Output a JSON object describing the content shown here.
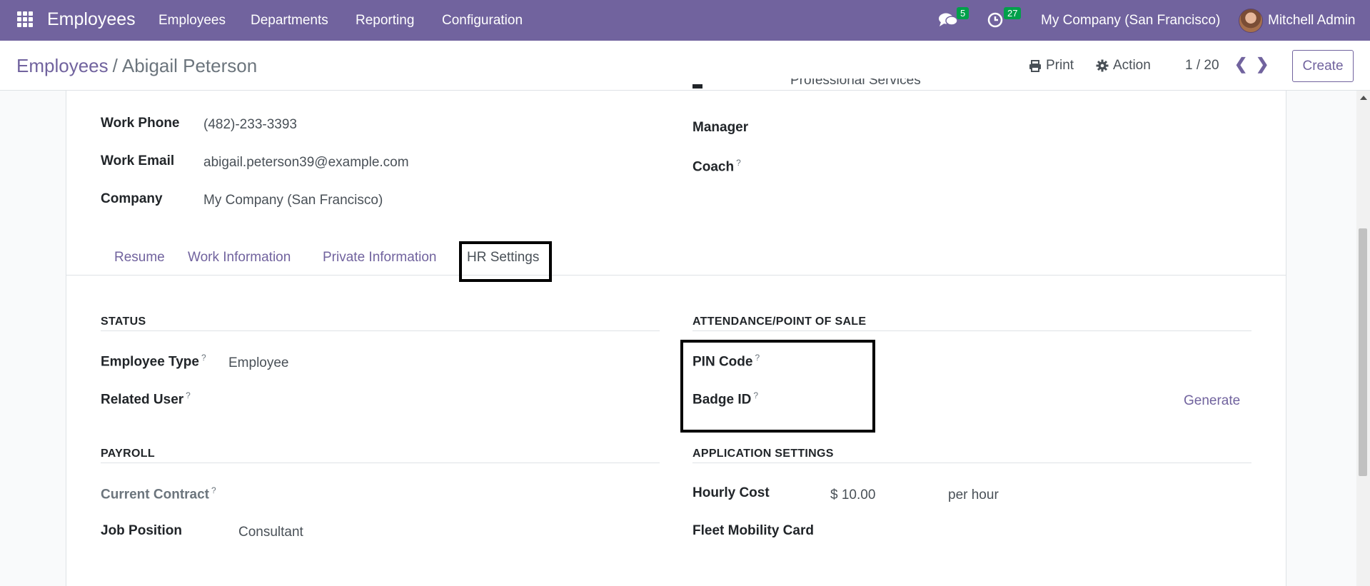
{
  "navbar": {
    "brand": "Employees",
    "menu": [
      "Employees",
      "Departments",
      "Reporting",
      "Configuration"
    ],
    "messages_count": "5",
    "activities_count": "27",
    "company": "My Company (San Francisco)",
    "user": "Mitchell Admin",
    "bg_color": "#71639e"
  },
  "control": {
    "breadcrumb_parent": "Employees",
    "breadcrumb_sep": "/",
    "breadcrumb_current": "Abigail Peterson",
    "print_label": "Print",
    "action_label": "Action",
    "pager": "1 / 20",
    "create_label": "Create"
  },
  "header_fields": {
    "work_phone_label": "Work Phone",
    "work_phone": "(482)-233-3393",
    "work_email_label": "Work Email",
    "work_email": "abigail.peterson39@example.com",
    "company_label": "Company",
    "company": "My Company (San Francisco)",
    "department_value_cut": "Professional Services",
    "manager_label": "Manager",
    "coach_label": "Coach"
  },
  "tabs": [
    "Resume",
    "Work Information",
    "Private Information",
    "HR Settings"
  ],
  "status": {
    "title": "STATUS",
    "employee_type_label": "Employee Type",
    "employee_type": "Employee",
    "related_user_label": "Related User"
  },
  "attendance": {
    "title": "ATTENDANCE/POINT OF SALE",
    "pin_label": "PIN Code",
    "badge_label": "Badge ID",
    "generate_label": "Generate"
  },
  "payroll": {
    "title": "PAYROLL",
    "contract_label": "Current Contract",
    "job_position_label": "Job Position",
    "job_position": "Consultant"
  },
  "application": {
    "title": "APPLICATION SETTINGS",
    "hourly_cost_label": "Hourly Cost",
    "hourly_cost": "$ 10.00",
    "per_hour": "per hour",
    "fleet_label": "Fleet Mobility Card"
  },
  "help_mark": "?"
}
